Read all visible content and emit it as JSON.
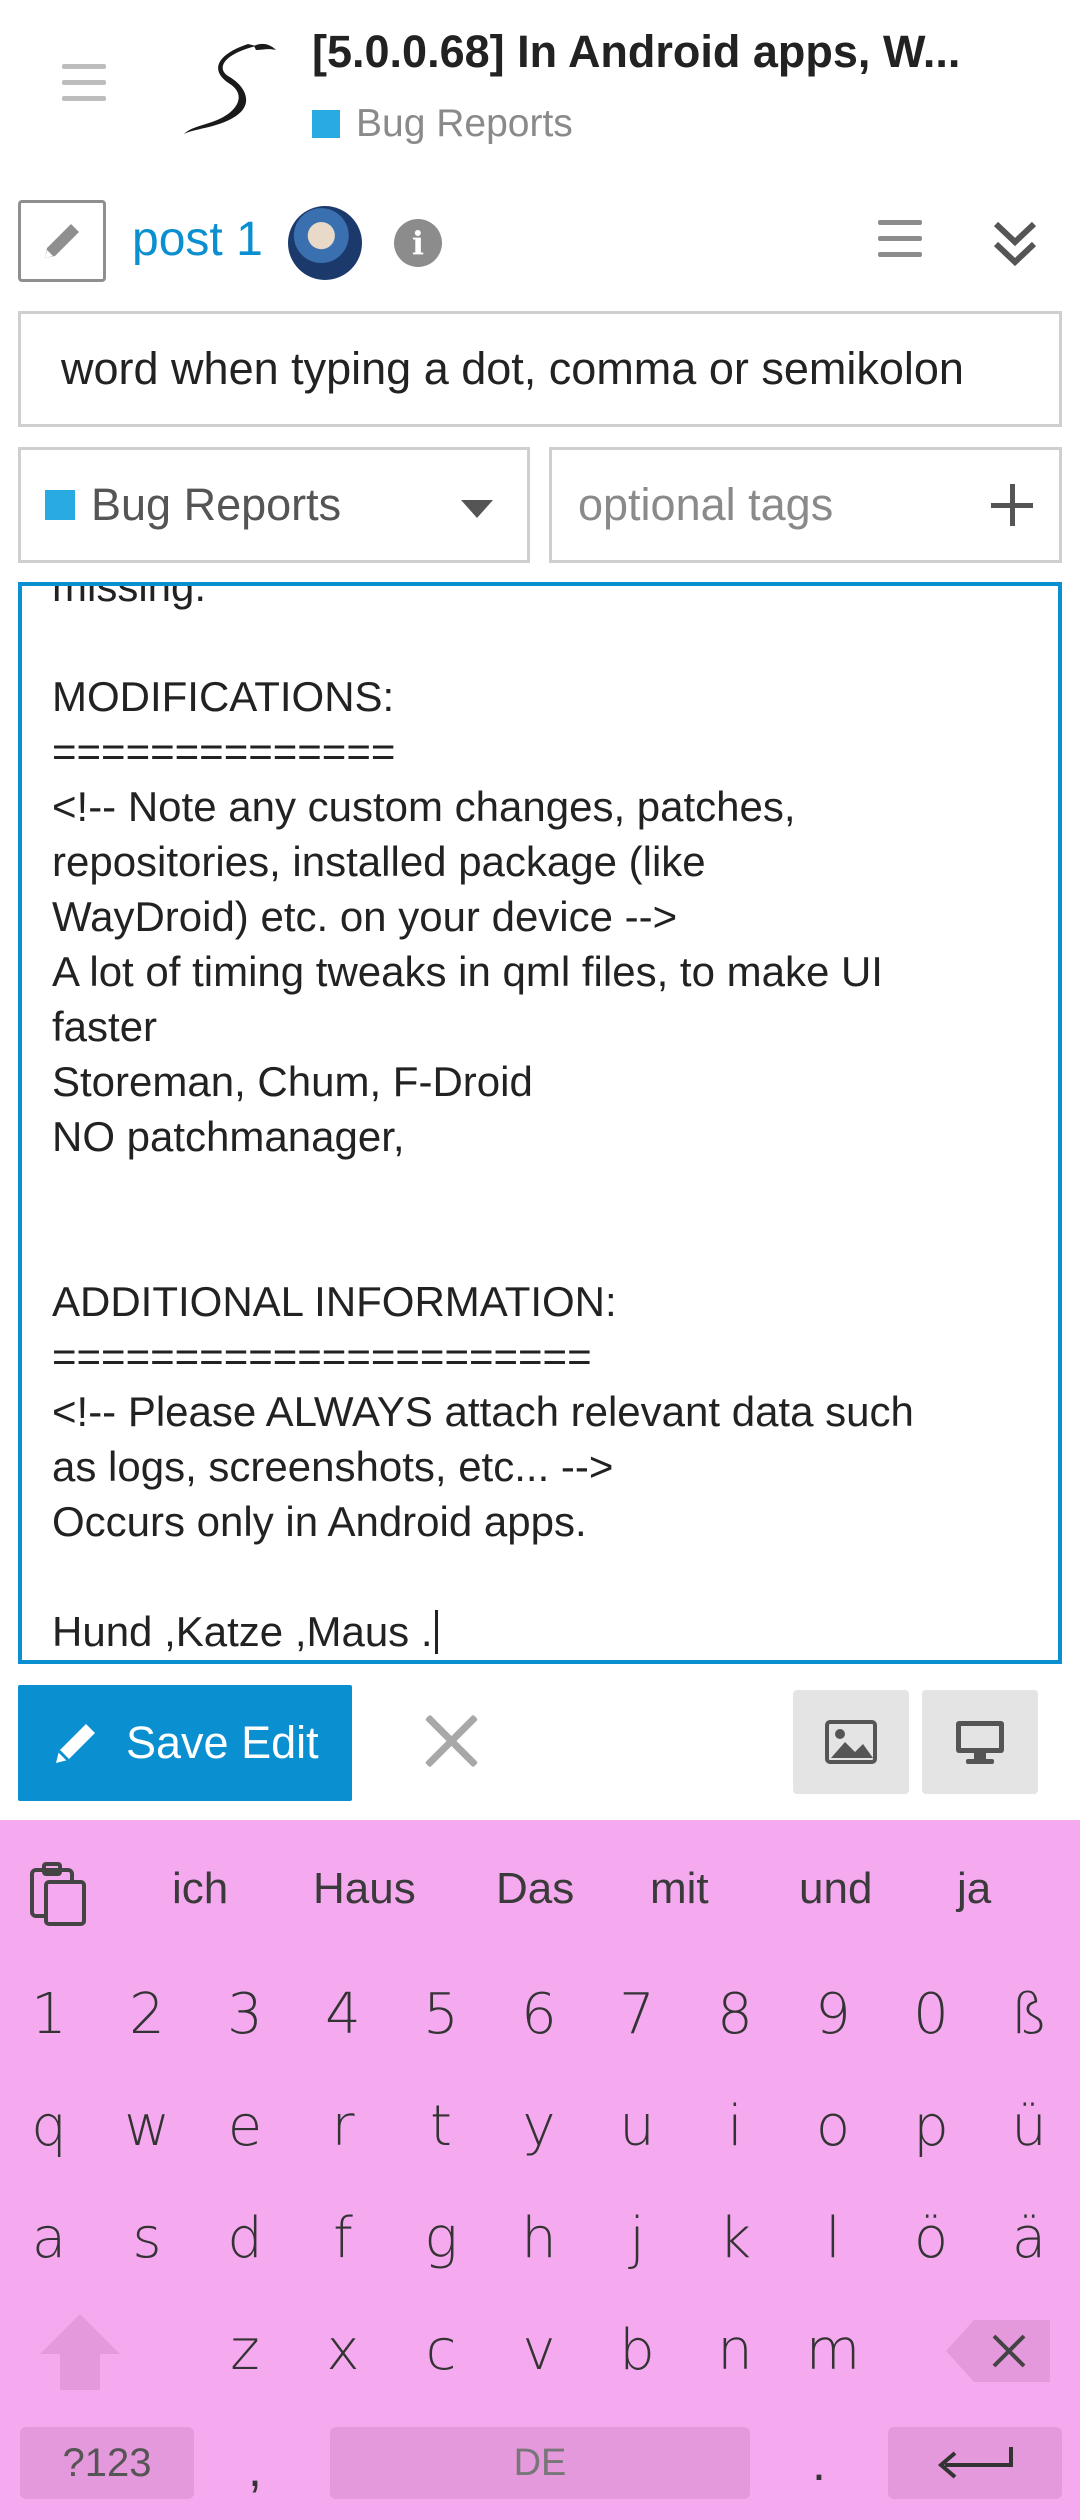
{
  "header": {
    "title": "[5.0.0.68] In Android apps, W...",
    "category": "Bug Reports",
    "category_color": "#29abe2"
  },
  "post_row": {
    "post_label": "post 1"
  },
  "composer": {
    "title_value": "word when typing a dot, comma or semikolon",
    "category_value": "Bug Reports",
    "tags_placeholder": "optional tags",
    "body_lines": [
      "missing.",
      "",
      "MODIFICATIONS:",
      "==============",
      "<!-- Note any custom changes, patches,",
      "repositories, installed package (like",
      "WayDroid) etc. on your device -->",
      "A lot of timing tweaks in qml files, to make UI",
      "faster",
      "Storeman, Chum, F-Droid",
      "NO patchmanager,",
      "",
      "",
      "ADDITIONAL INFORMATION:",
      "======================",
      "<!-- Please ALWAYS attach relevant data such",
      "as logs, screenshots, etc... -->",
      "Occurs only in Android apps.",
      "",
      "Hund ,Katze ,Maus ."
    ],
    "save_label": "Save Edit",
    "accent_color": "#0a8fd0"
  },
  "keyboard": {
    "suggestions": [
      "ich",
      "Haus",
      "Das",
      "mit",
      "und",
      "ja"
    ],
    "row_numbers": [
      "1",
      "2",
      "3",
      "4",
      "5",
      "6",
      "7",
      "8",
      "9",
      "0",
      "ß"
    ],
    "row_1": [
      "q",
      "w",
      "e",
      "r",
      "t",
      "y",
      "u",
      "i",
      "o",
      "p",
      "ü"
    ],
    "row_2": [
      "a",
      "s",
      "d",
      "f",
      "g",
      "h",
      "j",
      "k",
      "l",
      "ö",
      "ä"
    ],
    "row_3": [
      "z",
      "x",
      "c",
      "v",
      "b",
      "n",
      "m"
    ],
    "symbols_label": "?123",
    "comma": ",",
    "space_label": "DE",
    "period": ".",
    "background_color": "#f5aaf0"
  }
}
